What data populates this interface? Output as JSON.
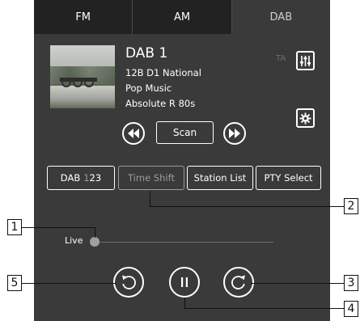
{
  "tabs": [
    {
      "label": "FM",
      "active": false
    },
    {
      "label": "AM",
      "active": false
    },
    {
      "label": "DAB",
      "active": true
    }
  ],
  "station": {
    "name": "DAB 1",
    "ensemble": "12B  D1 National",
    "genre": "Pop Music",
    "service": "Absolute R 80s",
    "ta_label": "TA"
  },
  "controls": {
    "scan_label": "Scan",
    "prev_icon": "seek-back-icon",
    "next_icon": "seek-forward-icon",
    "sound_settings_icon": "equalizer-icon",
    "settings_icon": "gear-icon"
  },
  "function_buttons": {
    "dab_prefix": "DAB",
    "dab_digit1": "1",
    "dab_digit2": "2",
    "dab_digit3": "3",
    "time_shift": "Time Shift",
    "station_list": "Station List",
    "pty_select": "PTY Select"
  },
  "timeshift": {
    "live_label": "Live",
    "position": 0
  },
  "callouts": [
    "1",
    "2",
    "3",
    "4",
    "5"
  ],
  "colors": {
    "panel": "#3a3a3a",
    "tab_bar": "#222222",
    "text": "#ffffff",
    "dimmed": "#9b9b9b"
  }
}
